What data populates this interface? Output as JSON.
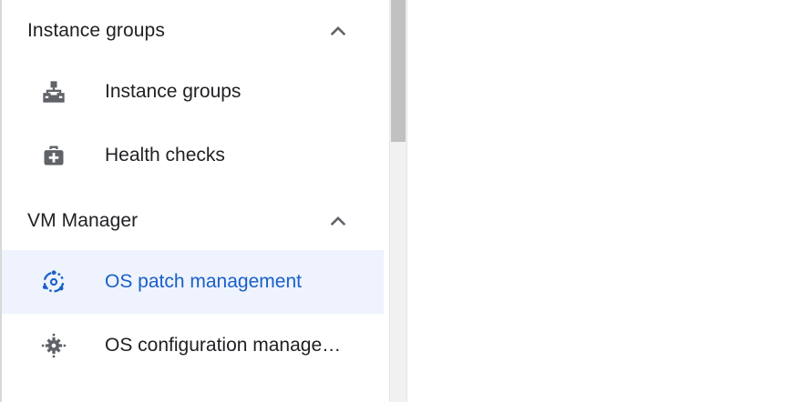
{
  "sidebar": {
    "sections": [
      {
        "title": "Instance groups",
        "expanded": true,
        "items": [
          {
            "label": "Instance groups",
            "icon": "instance-groups-icon",
            "active": false
          },
          {
            "label": "Health checks",
            "icon": "health-checks-icon",
            "active": false
          }
        ]
      },
      {
        "title": "VM Manager",
        "expanded": true,
        "items": [
          {
            "label": "OS patch management",
            "icon": "os-patch-management-icon",
            "active": true
          },
          {
            "label": "OS configuration management",
            "icon": "os-configuration-management-icon",
            "active": false
          }
        ]
      }
    ]
  },
  "colors": {
    "text": "#202124",
    "icon": "#5f6368",
    "active_text": "#1a5fc8",
    "active_bg": "#eef3fd",
    "scrollbar_track": "#f1f1f1",
    "scrollbar_thumb": "#c1c1c1"
  }
}
